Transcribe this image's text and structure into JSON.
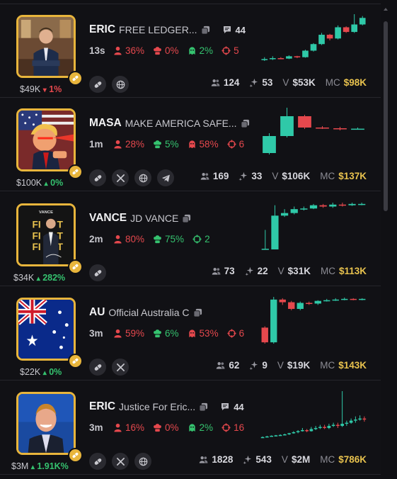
{
  "rows": [
    {
      "ticker": "ERIC",
      "name": "FREE LEDGER...",
      "has_chat": true,
      "chat_count": "44",
      "age": "13s",
      "top_holders_pct": "36%",
      "top_holders_color": "#e5484d",
      "dev_pct": "0%",
      "dev_color": "#e5484d",
      "snipers_pct": "2%",
      "snipers_color": "#35c26f",
      "target_count": "5",
      "target_color": "#e5484d",
      "market_cap_badge": "$49K",
      "change_pct": "1%",
      "change_dir": "down",
      "holders": "124",
      "txns": "53",
      "volume_label": "V",
      "volume": "$53K",
      "mc_label": "MC",
      "market_cap": "$98K",
      "socials": [
        "pill-icon",
        "globe-icon"
      ],
      "candles": [
        [
          1,
          1,
          1.2,
          0.8
        ],
        [
          1,
          1.1,
          1.3,
          0.9
        ],
        [
          1.1,
          1.05,
          1.2,
          1
        ],
        [
          1.05,
          1.3,
          1.4,
          1
        ],
        [
          1.3,
          1.2,
          1.35,
          1.1
        ],
        [
          1.2,
          1.9,
          2,
          1.15
        ],
        [
          1.9,
          2.6,
          2.7,
          1.8
        ],
        [
          2.6,
          3.6,
          3.8,
          2.5
        ],
        [
          3.6,
          3.2,
          3.7,
          3
        ],
        [
          3.2,
          4.4,
          4.6,
          3.1
        ],
        [
          4.4,
          3.9,
          4.5,
          3.8
        ],
        [
          3.9,
          4.7,
          5.8,
          3.8
        ],
        [
          4.7,
          5.4,
          5.6,
          4.6
        ]
      ]
    },
    {
      "ticker": "MASA",
      "name": "MAKE AMERICA SAFE...",
      "has_chat": false,
      "chat_count": "",
      "age": "1m",
      "top_holders_pct": "28%",
      "top_holders_color": "#e5484d",
      "dev_pct": "5%",
      "dev_color": "#35c26f",
      "snipers_pct": "58%",
      "snipers_color": "#e5484d",
      "target_count": "6",
      "target_color": "#e5484d",
      "market_cap_badge": "$100K",
      "change_pct": "0%",
      "change_dir": "up",
      "holders": "169",
      "txns": "33",
      "volume_label": "V",
      "volume": "$106K",
      "mc_label": "MC",
      "market_cap": "$137K",
      "socials": [
        "pill-icon",
        "x-icon",
        "globe-icon",
        "telegram-icon"
      ],
      "candles": [
        [
          1,
          2.2,
          2.4,
          0.9
        ],
        [
          2.2,
          3.6,
          4.2,
          2.1
        ],
        [
          3.6,
          2.8,
          3.7,
          2.7
        ],
        [
          2.8,
          2.75,
          2.9,
          2.7
        ],
        [
          2.75,
          2.7,
          2.85,
          2.6
        ],
        [
          2.7,
          2.72,
          2.8,
          2.65
        ]
      ]
    },
    {
      "ticker": "VANCE",
      "name": "JD VANCE",
      "has_chat": false,
      "chat_count": "",
      "age": "2m",
      "top_holders_pct": "80%",
      "top_holders_color": "#e5484d",
      "dev_pct": "75%",
      "dev_color": "#35c26f",
      "snipers_pct": "",
      "snipers_color": "",
      "target_count": "2",
      "target_color": "#35c26f",
      "market_cap_badge": "$34K",
      "change_pct": "282%",
      "change_dir": "up",
      "holders": "73",
      "txns": "22",
      "volume_label": "V",
      "volume": "$31K",
      "mc_label": "MC",
      "market_cap": "$113K",
      "socials": [
        "pill-icon"
      ],
      "candles": [
        [
          1,
          1.05,
          2.5,
          1
        ],
        [
          1,
          3.6,
          4.4,
          1
        ],
        [
          3.6,
          3.8,
          4.1,
          3.5
        ],
        [
          3.8,
          4.1,
          4.3,
          3.7
        ],
        [
          4.1,
          4.15,
          4.3,
          4
        ],
        [
          4.15,
          4.4,
          4.5,
          4.1
        ],
        [
          4.4,
          4.3,
          4.5,
          4.2
        ],
        [
          4.3,
          4.45,
          4.6,
          4.2
        ],
        [
          4.45,
          4.4,
          4.6,
          4.3
        ],
        [
          4.4,
          4.5,
          4.6,
          4.35
        ],
        [
          4.5,
          4.5,
          4.6,
          4.4
        ]
      ]
    },
    {
      "ticker": "AU",
      "name": "Official Australia C",
      "has_chat": false,
      "chat_count": "",
      "age": "3m",
      "top_holders_pct": "59%",
      "top_holders_color": "#e5484d",
      "dev_pct": "6%",
      "dev_color": "#35c26f",
      "snipers_pct": "53%",
      "snipers_color": "#e5484d",
      "target_count": "6",
      "target_color": "#e5484d",
      "market_cap_badge": "$22K",
      "change_pct": "0%",
      "change_dir": "up",
      "holders": "62",
      "txns": "9",
      "volume_label": "V",
      "volume": "$19K",
      "mc_label": "MC",
      "market_cap": "$143K",
      "socials": [
        "pill-icon",
        "x-icon"
      ],
      "candles": [
        [
          2.4,
          1.3,
          2.5,
          1.2
        ],
        [
          1.3,
          4.5,
          4.7,
          1.2
        ],
        [
          4.5,
          4.3,
          4.6,
          4.1
        ],
        [
          4.3,
          3.8,
          4.4,
          3.7
        ],
        [
          3.8,
          4.25,
          4.35,
          3.7
        ],
        [
          4.25,
          4.2,
          4.35,
          4.1
        ],
        [
          4.2,
          4.4,
          4.45,
          4.1
        ],
        [
          4.4,
          4.45,
          4.55,
          4.35
        ],
        [
          4.45,
          4.5,
          4.6,
          4.4
        ],
        [
          4.5,
          4.55,
          4.65,
          4.45
        ],
        [
          4.55,
          4.5,
          4.6,
          4.45
        ],
        [
          4.5,
          4.55,
          4.6,
          4.45
        ]
      ]
    },
    {
      "ticker": "ERIC",
      "name": "Justice For Eric...",
      "has_chat": true,
      "chat_count": "44",
      "age": "3m",
      "top_holders_pct": "16%",
      "top_holders_color": "#e5484d",
      "dev_pct": "0%",
      "dev_color": "#e5484d",
      "snipers_pct": "2%",
      "snipers_color": "#35c26f",
      "target_count": "16",
      "target_color": "#e5484d",
      "market_cap_badge": "$3M",
      "change_pct": "1.91K%",
      "change_dir": "up",
      "holders": "1828",
      "txns": "543",
      "volume_label": "V",
      "volume": "$2M",
      "mc_label": "MC",
      "market_cap": "$786K",
      "socials": [
        "pill-icon",
        "x-icon",
        "globe-icon"
      ],
      "candles": [
        [
          1,
          1.02,
          1.05,
          0.98
        ],
        [
          1.02,
          1.05,
          1.08,
          1
        ],
        [
          1.05,
          1.08,
          1.1,
          1.03
        ],
        [
          1.08,
          1.1,
          1.12,
          1.05
        ],
        [
          1.1,
          1.12,
          1.15,
          1.08
        ],
        [
          1.12,
          1.15,
          1.18,
          1.1
        ],
        [
          1.15,
          1.2,
          1.22,
          1.12
        ],
        [
          1.2,
          1.25,
          1.3,
          1.18
        ],
        [
          1.25,
          1.3,
          1.35,
          1.2
        ],
        [
          1.3,
          1.35,
          1.45,
          1.28
        ],
        [
          1.35,
          1.3,
          1.4,
          1.25
        ],
        [
          1.3,
          1.4,
          1.5,
          1.28
        ],
        [
          1.4,
          1.45,
          1.55,
          1.35
        ],
        [
          1.45,
          1.5,
          1.6,
          1.4
        ],
        [
          1.5,
          1.45,
          1.6,
          1.4
        ],
        [
          1.45,
          1.55,
          1.65,
          1.4
        ],
        [
          1.55,
          1.6,
          1.7,
          1.5
        ],
        [
          1.6,
          1.55,
          1.7,
          1.45
        ],
        [
          1.55,
          1.65,
          3.2,
          1.5
        ],
        [
          1.65,
          1.7,
          1.8,
          1.55
        ],
        [
          1.7,
          1.8,
          1.9,
          1.65
        ],
        [
          1.8,
          1.85,
          2,
          1.7
        ],
        [
          1.85,
          1.9,
          2.05,
          1.8
        ],
        [
          1.9,
          1.85,
          2,
          1.75
        ]
      ]
    }
  ]
}
